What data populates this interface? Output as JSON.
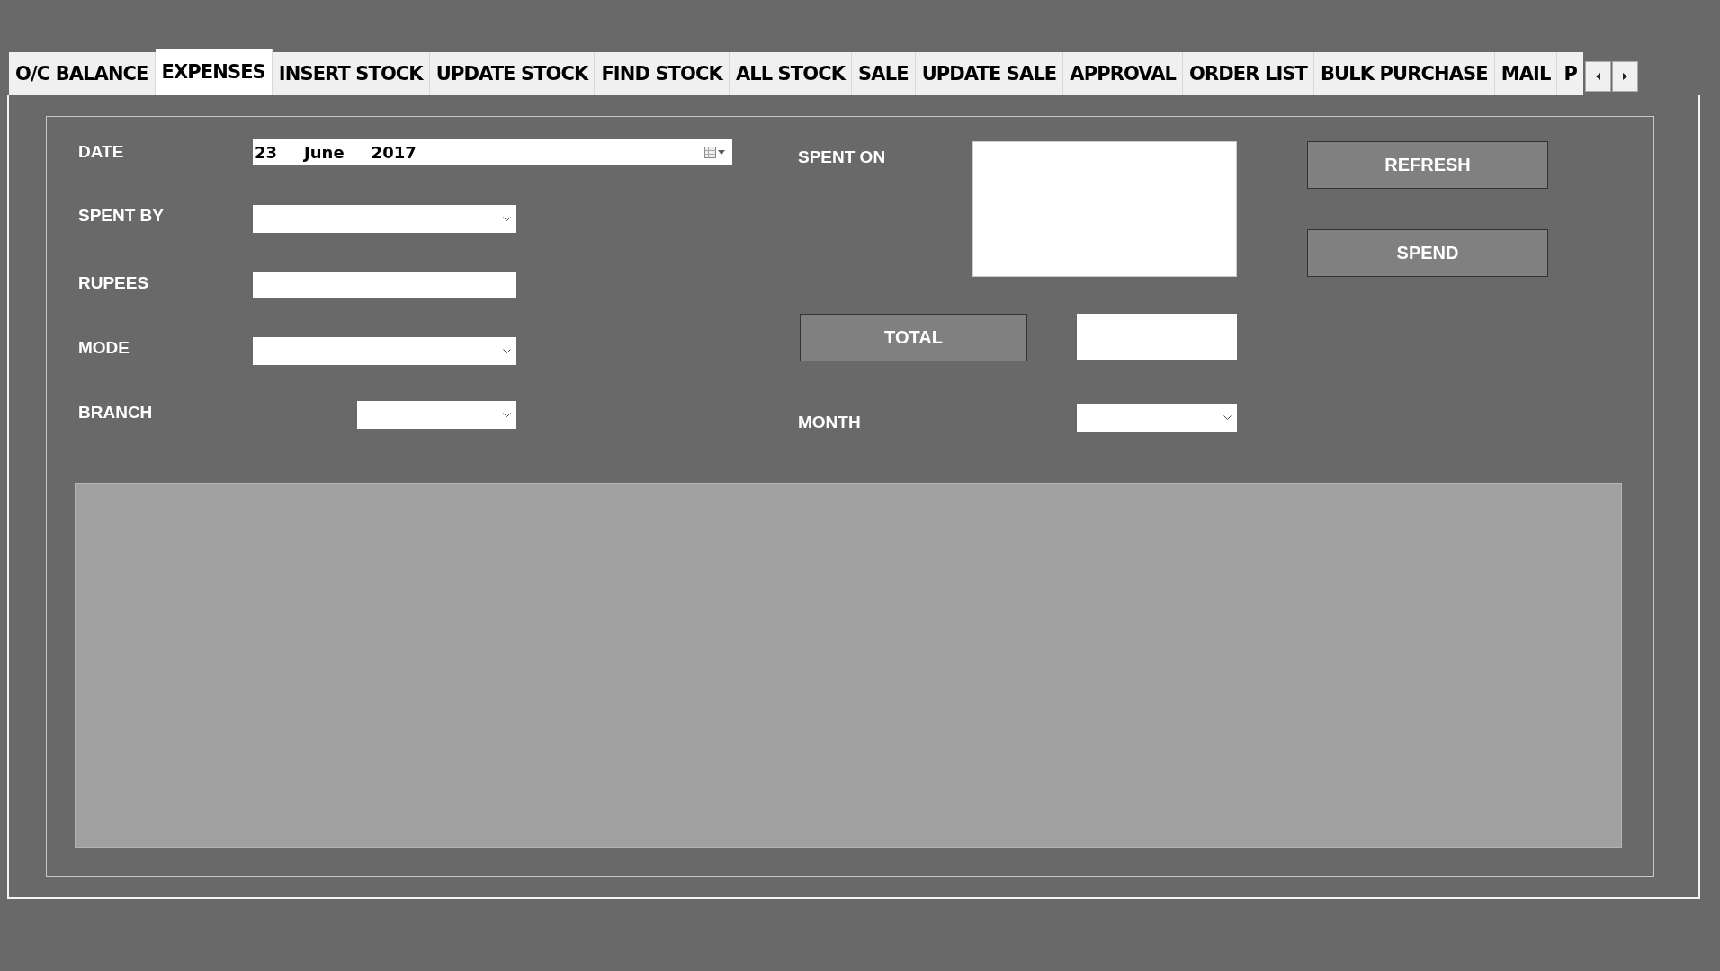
{
  "tabs": [
    {
      "label": "O/C BALANCE",
      "selected": false
    },
    {
      "label": "EXPENSES",
      "selected": true
    },
    {
      "label": "INSERT STOCK",
      "selected": false
    },
    {
      "label": "UPDATE STOCK",
      "selected": false
    },
    {
      "label": "FIND STOCK",
      "selected": false
    },
    {
      "label": "ALL STOCK",
      "selected": false
    },
    {
      "label": "SALE",
      "selected": false
    },
    {
      "label": "UPDATE SALE",
      "selected": false
    },
    {
      "label": "APPROVAL",
      "selected": false
    },
    {
      "label": "ORDER LIST",
      "selected": false
    },
    {
      "label": "BULK PURCHASE",
      "selected": false
    },
    {
      "label": "MAIL",
      "selected": false
    },
    {
      "label": "P",
      "selected": false
    }
  ],
  "fields": [
    {
      "label": "DATE",
      "kind": "date",
      "day": "23",
      "month": "June",
      "year": "2017"
    },
    {
      "label": "SPENT BY",
      "kind": "dropdown"
    },
    {
      "label": "RUPEES",
      "kind": "text"
    },
    {
      "label": "MODE",
      "kind": "dropdown"
    },
    {
      "label": "BRANCH",
      "kind": "dropdown"
    }
  ],
  "spent_on": {
    "label": "SPENT ON"
  },
  "buttons": [
    "REFRESH",
    "SPEND"
  ],
  "total": {
    "button": "TOTAL"
  },
  "month": {
    "label": "MONTH"
  }
}
